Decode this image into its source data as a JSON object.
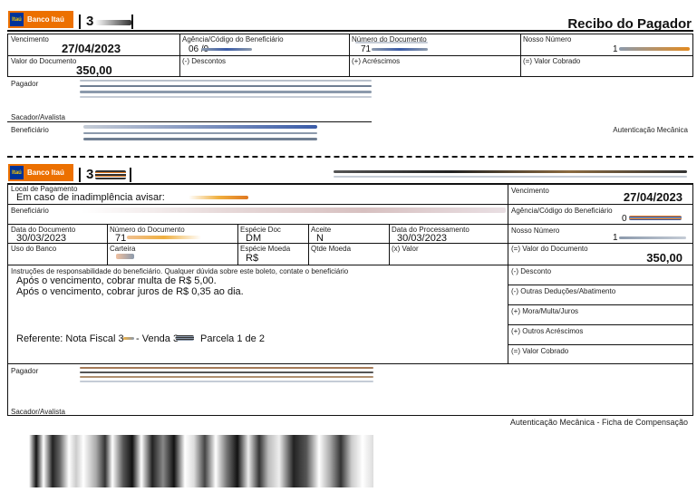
{
  "colors": {
    "brand_orange": "#ec7000",
    "brand_blue": "#003399",
    "brand_yellow": "#ffcc00",
    "redacted_grey": "#8c9aac",
    "redacted_orange": "#f0b040"
  },
  "top": {
    "bank_name": "Banco Itaú",
    "bank_code": "3",
    "title": "Recibo do Pagador",
    "vencimento_label": "Vencimento",
    "vencimento": "27/04/2023",
    "agencia_label": "Agência/Código do Beneficiário",
    "agencia": "06 /9",
    "numero_doc_label": "Número do Documento",
    "numero_doc": "71",
    "nosso_numero_label": "Nosso Número",
    "nosso_numero": "1",
    "valor_doc_label": "Valor do Documento",
    "valor_doc": "350,00",
    "descontos_label": "(-) Descontos",
    "acrescimos_label": "(+) Acréscimos",
    "valor_cobrado_label": "(=) Valor Cobrado",
    "pagador_label": "Pagador",
    "sacador_label": "Sacador/Avalista",
    "beneficiario_label": "Beneficiário",
    "autenticacao": "Autenticação Mecânica"
  },
  "ficha": {
    "bank_name": "Banco Itaú",
    "bank_code": "3",
    "local_pagamento_label": "Local de Pagamento",
    "local_pagamento": "Em caso de inadimplência avisar:",
    "vencimento_label": "Vencimento",
    "vencimento": "27/04/2023",
    "beneficiario_label": "Beneficiário",
    "agencia_label": "Agência/Código do Beneficiário",
    "agencia": "0",
    "data_doc_label": "Data do Documento",
    "data_doc": "30/03/2023",
    "numero_doc_label": "Número do Documento",
    "numero_doc": "71",
    "especie_doc_label": "Espécie Doc",
    "especie_doc": "DM",
    "aceite_label": "Aceite",
    "aceite": "N",
    "data_proc_label": "Data do Processamento",
    "data_proc": "30/03/2023",
    "nosso_numero_label": "Nosso Número",
    "nosso_numero": "1",
    "uso_banco_label": "Uso do Banco",
    "carteira_label": "Carteira",
    "especie_moeda_label": "Espécie Moeda",
    "especie_moeda": "R$",
    "qtde_moeda_label": "Qtde Moeda",
    "x_valor_label": "(x) Valor",
    "valor_doc_label": "(=) Valor do Documento",
    "valor_doc": "350,00",
    "instrucoes_label": "Instruções de responsabilidade do beneficiário. Qualquer dúvida sobre este boleto, contate o beneficiário",
    "instrucao_1": "Após o vencimento, cobrar multa de R$ 5,00.",
    "instrucao_2": "Após o vencimento, cobrar juros de R$ 0,35 ao dia.",
    "referente_1": "Referente: Nota Fiscal 3",
    "referente_2": "- Venda 3",
    "referente_3": "Parcela 1 de 2",
    "desconto_label": "(-) Desconto",
    "outras_deducoes_label": "(-) Outras Deduções/Abatimento",
    "mora_label": "(+) Mora/Multa/Juros",
    "outros_acrescimos_label": "(+) Outros Acréscimos",
    "valor_cobrado_label": "(=) Valor Cobrado",
    "pagador_label": "Pagador",
    "sacador_label": "Sacador/Avalista",
    "autenticacao": "Autenticação Mecânica - Ficha de Compensação"
  }
}
